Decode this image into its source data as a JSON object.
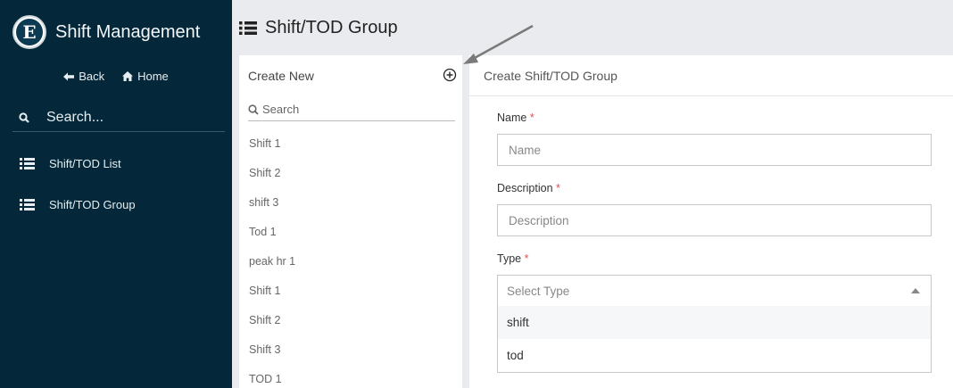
{
  "sidebar": {
    "brand_title": "Shift Management",
    "back_label": "Back",
    "home_label": "Home",
    "search_placeholder": "Search...",
    "menu": [
      {
        "label": "Shift/TOD List",
        "icon": "list-icon"
      },
      {
        "label": "Shift/TOD Group",
        "icon": "list-icon"
      }
    ]
  },
  "header": {
    "title": "Shift/TOD Group",
    "icon": "list-icon"
  },
  "list_panel": {
    "create_new_label": "Create New",
    "search_placeholder": "Search",
    "items": [
      "Shift 1",
      "Shift 2",
      "shift 3",
      "Tod 1",
      "peak hr 1",
      "Shift 1",
      "Shift 2",
      "Shift 3",
      "TOD 1"
    ]
  },
  "form": {
    "title": "Create Shift/TOD Group",
    "name_label": "Name",
    "name_placeholder": "Name",
    "description_label": "Description",
    "description_placeholder": "Description",
    "type_label": "Type",
    "required_marker": "*",
    "type_placeholder": "Select Type",
    "type_options": [
      "shift",
      "tod"
    ]
  },
  "colors": {
    "sidebar_bg": "#04283a",
    "page_bg": "#e9ebee",
    "required": "#d9534f",
    "annotation_arrow": "#7a7a7a"
  }
}
